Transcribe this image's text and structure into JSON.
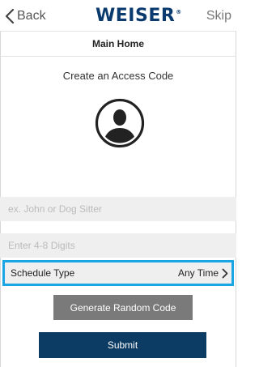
{
  "nav": {
    "back_label": "Back",
    "brand": "WEISER",
    "brand_mark": "®",
    "skip_label": "Skip"
  },
  "location_title": "Main Home",
  "heading": "Create an Access Code",
  "avatar_icon": "person-silhouette-icon",
  "name_input": {
    "placeholder": "ex. John or Dog Sitter",
    "value": ""
  },
  "code_input": {
    "placeholder": "Enter 4-8 Digits",
    "value": ""
  },
  "schedule": {
    "label": "Schedule Type",
    "value": "Any Time",
    "icon": "chevron-right-icon"
  },
  "buttons": {
    "generate": "Generate Random Code",
    "submit": "Submit"
  },
  "colors": {
    "brand_navy": "#0b3a6e",
    "submit_bg": "#0c3b63",
    "generate_bg": "#7a7a7a",
    "field_bg": "#efefef",
    "highlight": "#1aa6e4"
  }
}
